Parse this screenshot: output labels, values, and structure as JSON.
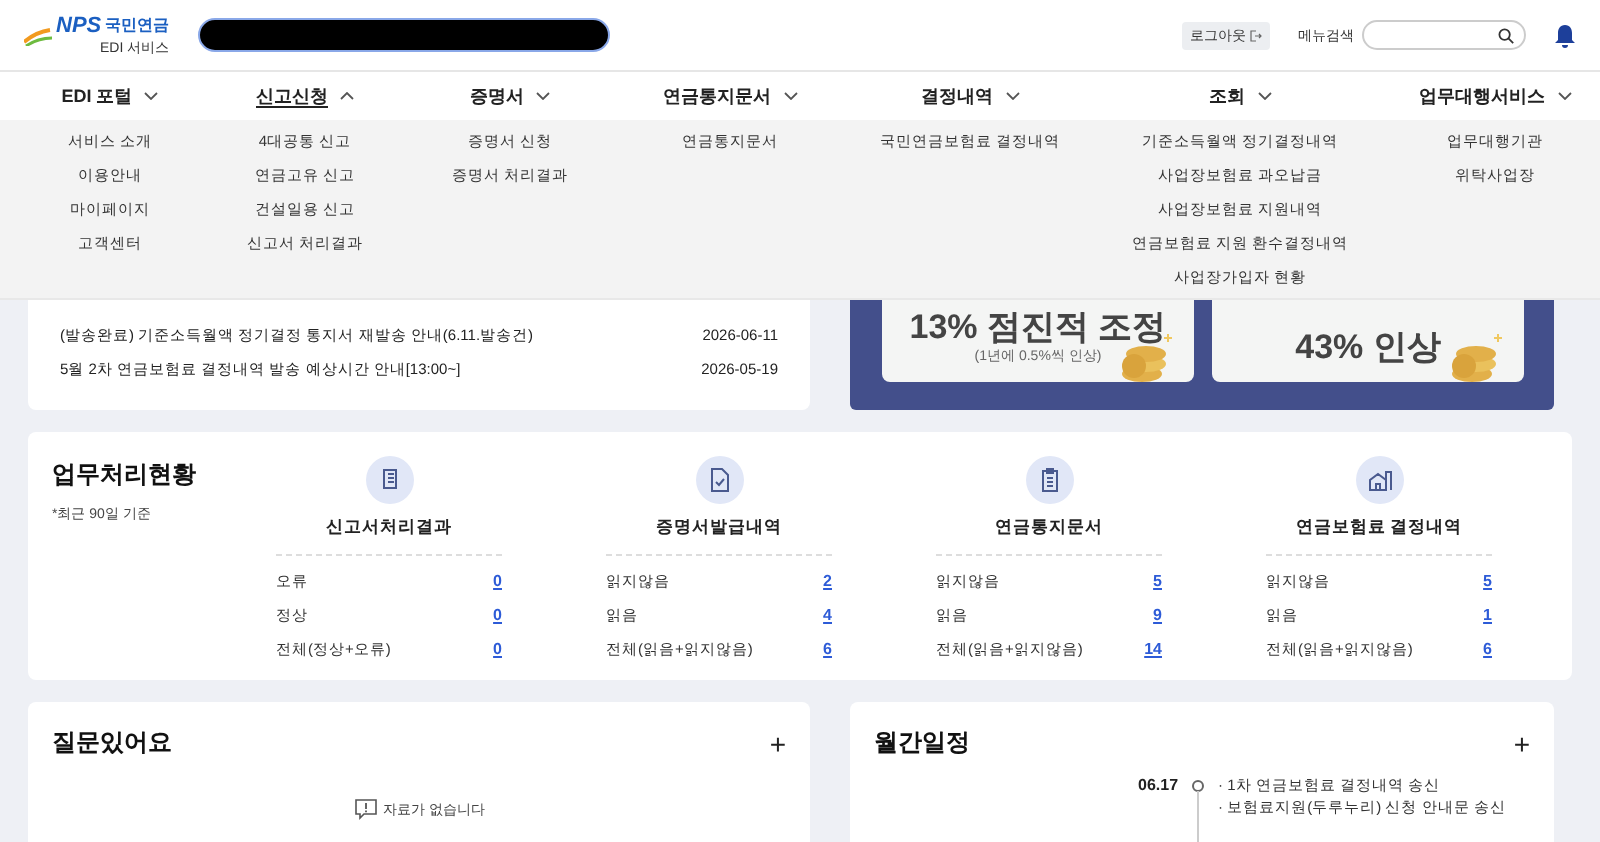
{
  "header": {
    "logo": {
      "mark": "NPS",
      "name": "국민연금",
      "sub": "EDI 서비스"
    },
    "logout": "로그아웃",
    "menu_search_label": "메뉴검색"
  },
  "nav": [
    {
      "label": "EDI 포털",
      "selected": false,
      "items": [
        "서비스 소개",
        "이용안내",
        "마이페이지",
        "고객센터"
      ]
    },
    {
      "label": "신고신청",
      "selected": true,
      "items": [
        "4대공통 신고",
        "연금고유 신고",
        "건설일용 신고",
        "신고서 처리결과"
      ]
    },
    {
      "label": "증명서",
      "selected": false,
      "items": [
        "증명서 신청",
        "증명서 처리결과"
      ]
    },
    {
      "label": "연금통지문서",
      "selected": false,
      "items": [
        "연금통지문서"
      ]
    },
    {
      "label": "결정내역",
      "selected": false,
      "items": [
        "국민연금보험료 결정내역"
      ]
    },
    {
      "label": "조회",
      "selected": false,
      "items": [
        "기준소득월액 정기결정내역",
        "사업장보험료 과오납금",
        "사업장보험료 지원내역",
        "연금보험료 지원 환수결정내역",
        "사업장가입자 현황"
      ]
    },
    {
      "label": "업무대행서비스",
      "selected": false,
      "items": [
        "업무대행기관",
        "위탁사업장"
      ]
    }
  ],
  "notices": [
    {
      "title": "(발송완료) 기준소득월액 정기결정 통지서 재발송 안내(6.11.발송건)",
      "date": "2026-06-11"
    },
    {
      "title": "5월 2차 연금보험료 결정내역 발송 예상시간 안내[13:00~]",
      "date": "2026-05-19"
    }
  ],
  "banner": [
    {
      "headline": "13% 점진적 조정",
      "note": "(1년에 0.5%씩 인상)"
    },
    {
      "headline": "43% 인상"
    }
  ],
  "work_status": {
    "title": "업무처리현황",
    "note": "*최근 90일 기준",
    "columns": [
      {
        "kind": "report",
        "title": "신고서처리결과",
        "rows": [
          {
            "label": "오류",
            "count": "0"
          },
          {
            "label": "정상",
            "count": "0"
          },
          {
            "label": "전체(정상+오류)",
            "count": "0"
          }
        ]
      },
      {
        "kind": "certificate",
        "title": "증명서발급내역",
        "rows": [
          {
            "label": "읽지않음",
            "count": "2"
          },
          {
            "label": "읽음",
            "count": "4"
          },
          {
            "label": "전체(읽음+읽지않음)",
            "count": "6"
          }
        ]
      },
      {
        "kind": "clipboard",
        "title": "연금통지문서",
        "rows": [
          {
            "label": "읽지않음",
            "count": "5"
          },
          {
            "label": "읽음",
            "count": "9"
          },
          {
            "label": "전체(읽음+읽지않음)",
            "count": "14"
          }
        ]
      },
      {
        "kind": "building",
        "title": "연금보험료 결정내역",
        "rows": [
          {
            "label": "읽지않음",
            "count": "5"
          },
          {
            "label": "읽음",
            "count": "1"
          },
          {
            "label": "전체(읽음+읽지않음)",
            "count": "6"
          }
        ]
      }
    ]
  },
  "qna": {
    "title": "질문있어요",
    "add": "+",
    "empty": "자료가 없습니다"
  },
  "schedule": {
    "title": "월간일정",
    "add": "+",
    "entries": [
      {
        "date": "06.17",
        "items": [
          "· 1차 연금보험료 결정내역 송신",
          "· 보험료지원(두루누리) 신청 안내문 송신"
        ]
      }
    ]
  }
}
